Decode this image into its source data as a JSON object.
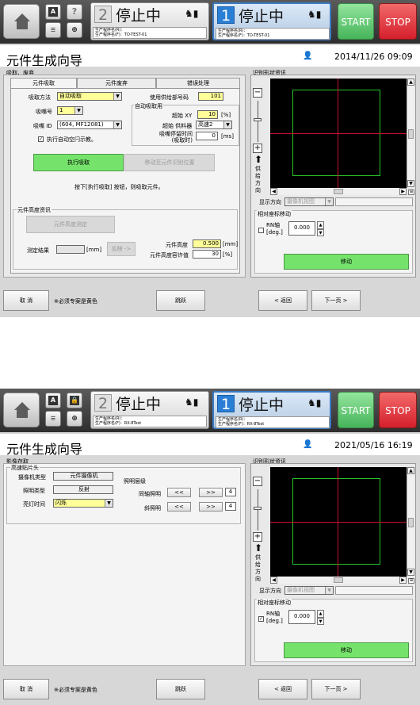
{
  "screens": [
    {
      "header": {
        "stage2": {
          "number": "2",
          "status": "停止中",
          "program_lines": [
            "生产程序名(R)：",
            "生产程序名(F)：TO-TEST-01"
          ]
        },
        "stage1": {
          "number": "1",
          "status": "停止中",
          "program_lines": [
            "生产程序名(R)：",
            "生产程序名(F)：TO-TEST-01"
          ]
        },
        "start_label": "START",
        "stop_label": "STOP",
        "small_buttons": [
          "A",
          "?",
          "☰",
          "⊕"
        ]
      },
      "title": "元件生成向导",
      "datetime": "2014/11/26 09:09",
      "section_title": "吸取、废弃",
      "tabs": [
        "元件吸取",
        "元件废弃",
        "错误处理"
      ],
      "pick": {
        "method_label": "吸取方法",
        "method_value": "自动吸取",
        "nozzle_no_label": "吸嘴号",
        "nozzle_no_value": "1",
        "nozzle_id_label": "吸嘴 ID",
        "nozzle_id_value": "(604, MF12081)",
        "auto_empty_label": "执行自动空闩示教。",
        "feeder_label": "使用供给部号码",
        "feeder_value": "101",
        "auto_group_title": "自动吸取用",
        "xy_label": "超始 XY",
        "xy_value": "10",
        "xy_unit": "[%]",
        "speed_label": "超始 供料器",
        "speed_value": "高速2",
        "stop_label": "吸嘴停留时间\n(吸取时)",
        "stop_value": "0",
        "stop_unit": "[ms]",
        "exec_button": "执行吸取",
        "move_button": "移动至元件识别位置",
        "hint": "按下[执行吸取] 按钮，则吸取元件。",
        "height_group_title": "元件高度资讯",
        "height_measure_button": "元件高度测定",
        "result_label": "测定结果",
        "result_unit": "[mm]",
        "reflect_button": "反映 ->",
        "height_label": "元件高度",
        "height_value": "0.500",
        "height_unit": "[mm]",
        "tolerance_label": "元件高度容许值",
        "tolerance_value": "30",
        "tolerance_unit": "[%]"
      },
      "viewer": {
        "title": "识别形状资讯",
        "feed_direction": [
          "供",
          "给",
          "方",
          "向"
        ],
        "display_dir_label": "显示方向",
        "display_dir_value": "摄像机视图",
        "rel_move_title": "相对座标移动",
        "rn_axis_label": "RN轴\n[deg.]",
        "rn_value": "0.000",
        "move_button": "移动"
      },
      "bottom": {
        "cancel": "取 消",
        "note": "※必须专案是黄色",
        "skip": "跳跃",
        "back": "< 返回",
        "next": "下一页 >"
      }
    },
    {
      "header": {
        "stage2": {
          "number": "2",
          "status": "停止中",
          "program_lines": [
            "生产程序名(R)：",
            "生产程序名(F)：RX-8Test"
          ]
        },
        "stage1": {
          "number": "1",
          "status": "停止中",
          "program_lines": [
            "生产程序名(R)：",
            "生产程序名(F)：RX-8Test"
          ]
        },
        "start_label": "START",
        "stop_label": "STOP",
        "small_buttons": [
          "A",
          "🔒",
          "☰",
          "⊕"
        ]
      },
      "title": "元件生成向导",
      "datetime": "2021/05/16 16:19",
      "section_title": "影像存取",
      "image": {
        "group_title": "高速贴片头",
        "camera_type_label": "摄像机类型",
        "camera_type_value": "元件摄像机",
        "light_type_label": "照明类型",
        "light_type_value": "反射",
        "on_time_label": "亮灯时间",
        "on_time_value": "闪烁",
        "level_title": "照明层级",
        "coax_label": "同轴照明",
        "coax_value": "4",
        "oblique_label": "斜照明",
        "oblique_value": "4",
        "dec_label": "<<",
        "inc_label": ">>"
      },
      "viewer": {
        "title": "识别形状资讯",
        "feed_direction": [
          "供",
          "给",
          "方",
          "向"
        ],
        "display_dir_label": "显示方向",
        "display_dir_value": "摄像机视图",
        "rel_move_title": "相对座标移动",
        "rn_axis_label": "RN轴\n[deg.]",
        "rn_value": "0.000",
        "move_button": "移动"
      },
      "bottom": {
        "cancel": "取 消",
        "note": "※必须专案是黄色",
        "skip": "跳跃",
        "back": "< 返回",
        "next": "下一页 >"
      }
    }
  ]
}
